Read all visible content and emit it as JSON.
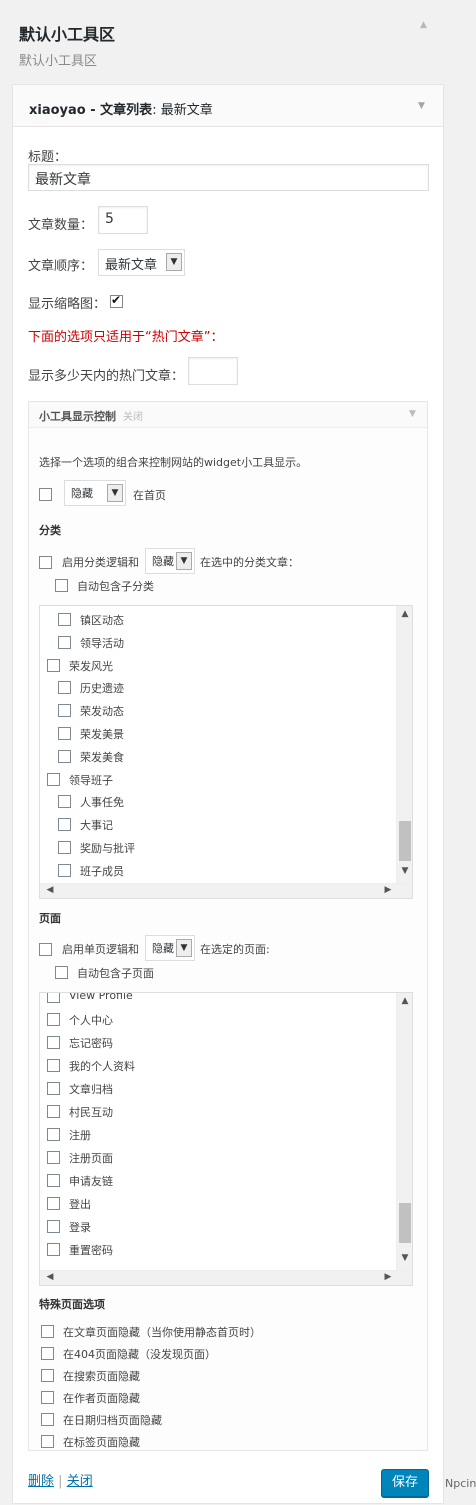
{
  "sidebar": {
    "title": "默认小工具区",
    "description": "默认小工具区"
  },
  "widget": {
    "title_prefix": "xiaoyao - ",
    "title_strong": "文章列表",
    "title_suffix": ": 最新文章",
    "title_label": "标题：",
    "title_value": "最新文章",
    "count_label": "文章数量：",
    "count_value": "5",
    "order_label": "文章顺序：",
    "order_value": "最新文章",
    "thumb_label": "显示缩略图：",
    "thumb_checked": true,
    "hot_note": "下面的选项只适用于“热门文章”：",
    "days_label": "显示多少天内的热门文章：",
    "days_value": ""
  },
  "display_control": {
    "title": "小工具显示控制",
    "close": "关闭",
    "intro": "选择一个选项的组合来控制网站的widget小工具显示。",
    "home_select": "隐藏",
    "home_text": "在首页",
    "category_heading": "分类",
    "cat_logic_label": "启用分类逻辑和",
    "cat_logic_select": "隐藏",
    "cat_logic_suffix": "在选中的分类文章：",
    "cat_include_children": "自动包含子分类",
    "categories": [
      {
        "label": "镇区动态",
        "level": 1
      },
      {
        "label": "领导活动",
        "level": 1
      },
      {
        "label": "荣发风光",
        "level": 0
      },
      {
        "label": "历史遗迹",
        "level": 1
      },
      {
        "label": "荣发动态",
        "level": 1
      },
      {
        "label": "荣发美景",
        "level": 1
      },
      {
        "label": "荣发美食",
        "level": 1
      },
      {
        "label": "领导班子",
        "level": 0
      },
      {
        "label": "人事任免",
        "level": 1
      },
      {
        "label": "大事记",
        "level": 1
      },
      {
        "label": "奖励与批评",
        "level": 1
      },
      {
        "label": "班子成员",
        "level": 1
      }
    ],
    "page_heading": "页面",
    "page_logic_label": "启用单页逻辑和",
    "page_logic_select": "隐藏",
    "page_logic_suffix": "在选定的页面:",
    "page_include_children": "自动包含子页面",
    "pages": [
      "View Profile",
      "个人中心",
      "忘记密码",
      "我的个人资料",
      "文章归档",
      "村民互动",
      "注册",
      "注册页面",
      "申请友链",
      "登出",
      "登录",
      "重置密码"
    ],
    "special_heading": "特殊页面选项",
    "special_options": [
      "在文章页面隐藏（当你使用静态首页时）",
      "在404页面隐藏（没发现页面）",
      "在搜索页面隐藏",
      "在作者页面隐藏",
      "在日期归档页面隐藏",
      "在标签页面隐藏"
    ]
  },
  "footer": {
    "delete": "删除",
    "separator": "|",
    "close": "关闭",
    "save": "保存"
  },
  "watermark": "Npcink",
  "icons": {
    "collapse": "triangle-up-icon",
    "expand": "triangle-down-icon"
  },
  "colors": {
    "accent": "#0085ba",
    "warning": "#d20000"
  }
}
